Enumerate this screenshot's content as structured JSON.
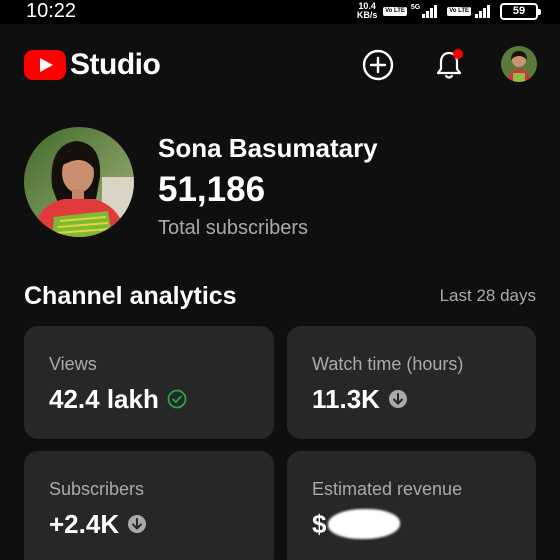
{
  "status_bar": {
    "time": "10:22",
    "net_speed_value": "10.4",
    "net_speed_unit": "KB/s",
    "sim1_badge": "Vo LTE",
    "sim1_network": "5G",
    "sim2_badge": "Vo LTE",
    "battery": "59"
  },
  "app_bar": {
    "logo_text": "Studio",
    "notification_dot": true
  },
  "profile": {
    "channel_name": "Sona Basumatary",
    "subscriber_count": "51,186",
    "subscriber_label": "Total subscribers"
  },
  "analytics": {
    "title": "Channel analytics",
    "range": "Last 28 days",
    "cards": [
      {
        "label": "Views",
        "value": "42.4 lakh",
        "indicator": "check-circle-icon"
      },
      {
        "label": "Watch time (hours)",
        "value": "11.3K",
        "indicator": "arrow-down-circle-icon"
      },
      {
        "label": "Subscribers",
        "value": "+2.4K",
        "indicator": "arrow-down-circle-icon"
      },
      {
        "label": "Estimated revenue",
        "value": "$",
        "indicator": "redacted"
      }
    ]
  },
  "colors": {
    "background": "#0f0f0f",
    "card": "#272727",
    "brand_red": "#ff0000",
    "positive_green": "#2ba640",
    "secondary_text": "#aaaaaa"
  }
}
